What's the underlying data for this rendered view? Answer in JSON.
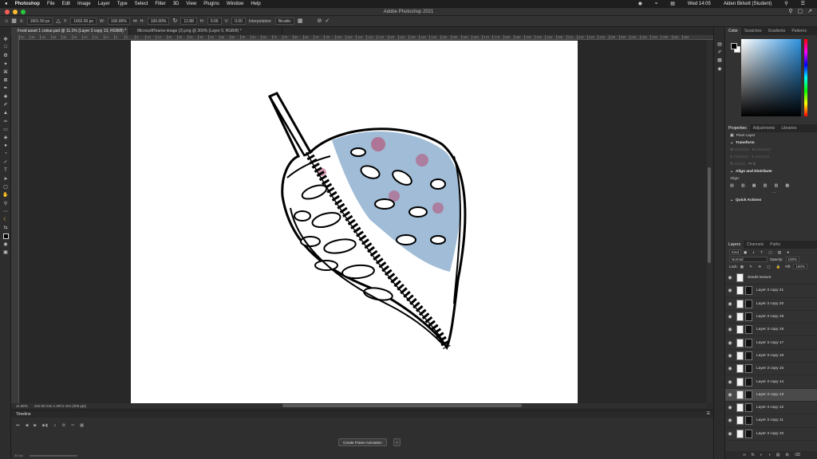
{
  "menubar": {
    "apple": "",
    "app": "Photoshop",
    "items": [
      "File",
      "Edit",
      "Image",
      "Layer",
      "Type",
      "Select",
      "Filter",
      "3D",
      "View",
      "Plugins",
      "Window",
      "Help"
    ],
    "clock": "Wed 14:05",
    "user": "Aiden Birkett (Student)"
  },
  "window": {
    "title": "Adobe Photoshop 2021"
  },
  "options": {
    "x": "1601.50 px",
    "y": "1602.00 px",
    "w": "100.00%",
    "h": "100.00%",
    "angle": "12.88",
    "h_skew": "0.00",
    "v_skew": "0.00",
    "interpolation_label": "Interpolation:",
    "interpolation": "Bicubic"
  },
  "tabs": [
    {
      "label": "Food asset 1 colour.psd @ 11.1% (Layer 3 copy 13, RGB/8) *"
    },
    {
      "label": "MicrosoftTeams-image (2).png @ 300% (Layer 0, RGB/8) *"
    }
  ],
  "rulers": {
    "top": [
      "50",
      "45",
      "40",
      "35",
      "30",
      "25",
      "20",
      "15",
      "10",
      "5",
      "0",
      "5",
      "10",
      "15",
      "20",
      "25",
      "30",
      "35",
      "40",
      "45",
      "50",
      "55",
      "60",
      "65",
      "70",
      "75",
      "80",
      "85",
      "90",
      "95",
      "100",
      "105",
      "110",
      "115",
      "120",
      "125",
      "130",
      "135",
      "140",
      "145",
      "150",
      "155",
      "160",
      "165",
      "170",
      "175",
      "180",
      "185",
      "190",
      "195",
      "200",
      "205",
      "210",
      "215",
      "220",
      "225",
      "230",
      "235",
      "240",
      "245",
      "250",
      "255",
      "260",
      "265"
    ]
  },
  "status": {
    "zoom": "11.66%",
    "dimensions": "210.00 mm x 2971 mm (300 ppi)"
  },
  "timeline": {
    "title": "Timeline",
    "create_button": "Create Frame Animation",
    "frame_rate": "30 fps"
  },
  "color_panel": {
    "tabs": [
      "Color",
      "Swatches",
      "Gradients",
      "Patterns"
    ],
    "fg": "#000000",
    "bg": "#ffffff"
  },
  "properties_panel": {
    "tabs": [
      "Properties",
      "Adjustments",
      "Libraries"
    ],
    "layer_type": "Pixel Layer",
    "transform_heading": "Transform",
    "align_heading": "Align and Distribute",
    "align_label": "Align:",
    "quick_actions_heading": "Quick Actions"
  },
  "layers_panel": {
    "tabs": [
      "Layers",
      "Channels",
      "Paths"
    ],
    "kind_label": "Kind",
    "blend_mode": "Normal",
    "opacity_label": "Opacity:",
    "opacity": "100%",
    "lock_label": "Lock:",
    "fill_label": "Fill:",
    "fill": "100%",
    "layers": [
      {
        "name": "Seeds texture",
        "selected": false,
        "has_mask": false
      },
      {
        "name": "Layer 3 copy 21",
        "selected": false,
        "has_mask": true
      },
      {
        "name": "Layer 3 copy 20",
        "selected": false,
        "has_mask": true
      },
      {
        "name": "Layer 3 copy 19",
        "selected": false,
        "has_mask": true
      },
      {
        "name": "Layer 3 copy 18",
        "selected": false,
        "has_mask": true
      },
      {
        "name": "Layer 3 copy 17",
        "selected": false,
        "has_mask": true
      },
      {
        "name": "Layer 3 copy 16",
        "selected": false,
        "has_mask": true
      },
      {
        "name": "Layer 3 copy 15",
        "selected": false,
        "has_mask": true
      },
      {
        "name": "Layer 3 copy 14",
        "selected": false,
        "has_mask": true
      },
      {
        "name": "Layer 3 copy 13",
        "selected": true,
        "has_mask": true
      },
      {
        "name": "Layer 3 copy 12",
        "selected": false,
        "has_mask": true
      },
      {
        "name": "Layer 3 copy 11",
        "selected": false,
        "has_mask": true
      },
      {
        "name": "Layer 3 copy 10",
        "selected": false,
        "has_mask": true
      }
    ]
  },
  "colors": {
    "accent_red": "#ff5f57",
    "accent_yellow": "#febc2e",
    "accent_green": "#28c840",
    "texture_blue": "#7aa1c7",
    "texture_pink": "#b4577b"
  }
}
